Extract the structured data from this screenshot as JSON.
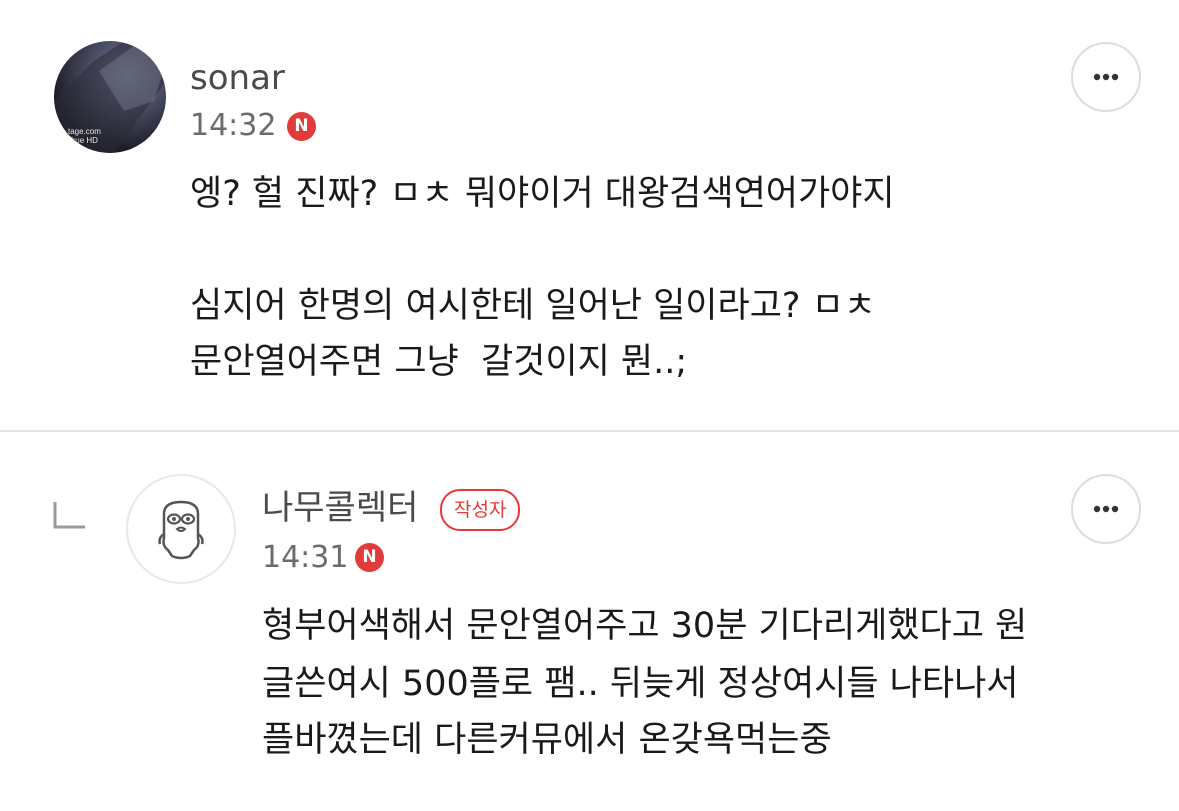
{
  "comments": [
    {
      "nickname": "sonar",
      "time": "14:32",
      "new_badge": "N",
      "avatar_watermark_1": "tage.com",
      "avatar_watermark_2": "True HD",
      "lines": [
        "엥? 헐 진짜? ㅁㅊ 뭐야이거 대왕검색연어가야지",
        "",
        "심지어 한명의 여시한테 일어난 일이라고? ㅁㅊ",
        "문안열어주면 그냥  갈것이지 뭔..;"
      ]
    },
    {
      "nickname": "나무콜렉터",
      "author_badge": "작성자",
      "time": "14:31",
      "new_badge": "N",
      "is_reply": true,
      "lines": [
        "형부어색해서 문안열어주고 30분 기다리게했다고 원",
        "글쓴여시 500플로 팸.. 뒤늦게 정상여시들 나타나서",
        "플바꼈는데 다른커뮤에서 온갖욕먹는중"
      ]
    }
  ],
  "colors": {
    "accent_red": "#e23b3b",
    "divider": "#e6e6e6",
    "text": "#1a1a1a",
    "meta": "#6b6b6b"
  },
  "icons": {
    "more": "more-horizontal-icon",
    "reply": "reply-arrow-icon",
    "new": "new-badge-icon"
  }
}
